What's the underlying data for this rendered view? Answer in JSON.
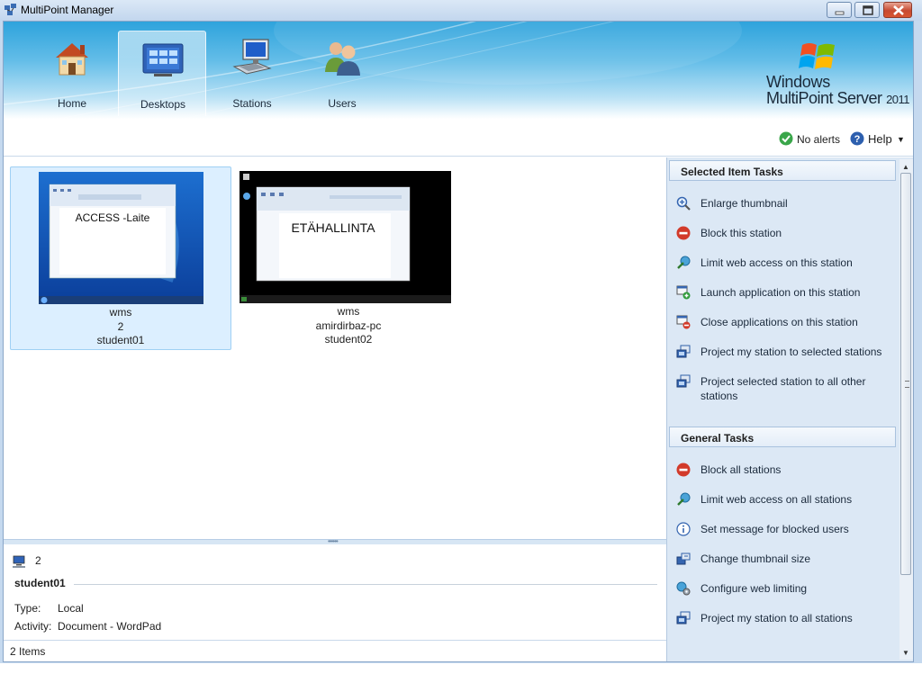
{
  "window": {
    "title": "MultiPoint Manager",
    "controls": [
      "minimize",
      "maximize",
      "close"
    ]
  },
  "ribbon": {
    "tabs": [
      {
        "label": "Home",
        "icon": "house-icon"
      },
      {
        "label": "Desktops",
        "icon": "desktops-icon",
        "active": true
      },
      {
        "label": "Stations",
        "icon": "station-icon"
      },
      {
        "label": "Users",
        "icon": "users-icon"
      }
    ],
    "brand": {
      "line1": "Windows",
      "line2": "MultiPoint Server",
      "year": "2011"
    }
  },
  "toolbar": {
    "alerts_label": "No alerts",
    "help_label": "Help"
  },
  "stations": [
    {
      "screen_text": "ACCESS -Laite",
      "server": "wms",
      "station": "2",
      "user": "student01",
      "selected": true
    },
    {
      "screen_text": "ETÄHALLINTA",
      "server": "wms",
      "station": "amirdirbaz-pc",
      "user": "student02",
      "selected": false
    }
  ],
  "details": {
    "station_number": "2",
    "user": "student01",
    "type_label": "Type:",
    "type_value": "Local",
    "activity_label": "Activity:",
    "activity_value": "Document - WordPad"
  },
  "status": {
    "items_text": "2 Items"
  },
  "task_pane": {
    "selected_header": "Selected Item Tasks",
    "selected_tasks": [
      {
        "label": "Enlarge thumbnail",
        "icon": "magnifier-icon"
      },
      {
        "label": "Block this station",
        "icon": "block-icon"
      },
      {
        "label": "Limit web access on this station",
        "icon": "web-limit-icon"
      },
      {
        "label": "Launch application on this station",
        "icon": "launch-app-icon"
      },
      {
        "label": "Close applications on this station",
        "icon": "close-app-icon"
      },
      {
        "label": "Project my station to selected stations",
        "icon": "project-icon"
      },
      {
        "label": "Project selected station to all other stations",
        "icon": "project-all-icon"
      }
    ],
    "general_header": "General Tasks",
    "general_tasks": [
      {
        "label": "Block all stations",
        "icon": "block-icon"
      },
      {
        "label": "Limit web access on all stations",
        "icon": "web-limit-icon"
      },
      {
        "label": "Set message for blocked users",
        "icon": "info-icon"
      },
      {
        "label": "Change thumbnail size",
        "icon": "thumbnail-size-icon"
      },
      {
        "label": "Configure web limiting",
        "icon": "gear-globe-icon"
      },
      {
        "label": "Project my station to all stations",
        "icon": "project-icon"
      }
    ]
  },
  "colors": {
    "ribbon_top": "#2ea3dc",
    "task_pane_bg": "#dce8f5",
    "selected_tile": "#dcefff",
    "block_red": "#d23a2a",
    "ok_green": "#3aa64a",
    "help_blue": "#2d5fae"
  }
}
